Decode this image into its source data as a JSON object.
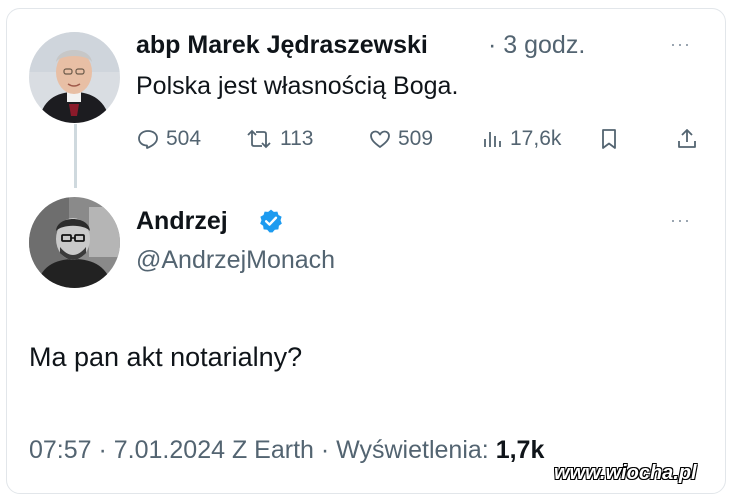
{
  "tweet1": {
    "author_name": "abp Marek Jędraszewski",
    "time_meta": "· 3 godz.",
    "text": "Polska jest własnością Boga.",
    "more": "···",
    "stats": {
      "replies": "504",
      "retweets": "113",
      "likes": "509",
      "views": "17,6k"
    }
  },
  "tweet2": {
    "author_name": "Andrzej",
    "handle": "@AndrzejMonach",
    "text": "Ma pan akt notarialny?",
    "more": "···",
    "footer_meta": "07:57 · 7.01.2024 Z Earth · Wyświetlenia: ",
    "footer_views": "1,7k"
  },
  "watermark": "www.wiocha.pl",
  "colors": {
    "text_primary": "#0f1419",
    "text_secondary": "#536471",
    "verified_blue": "#1d9bf0",
    "thread_line": "#cfd9de"
  }
}
